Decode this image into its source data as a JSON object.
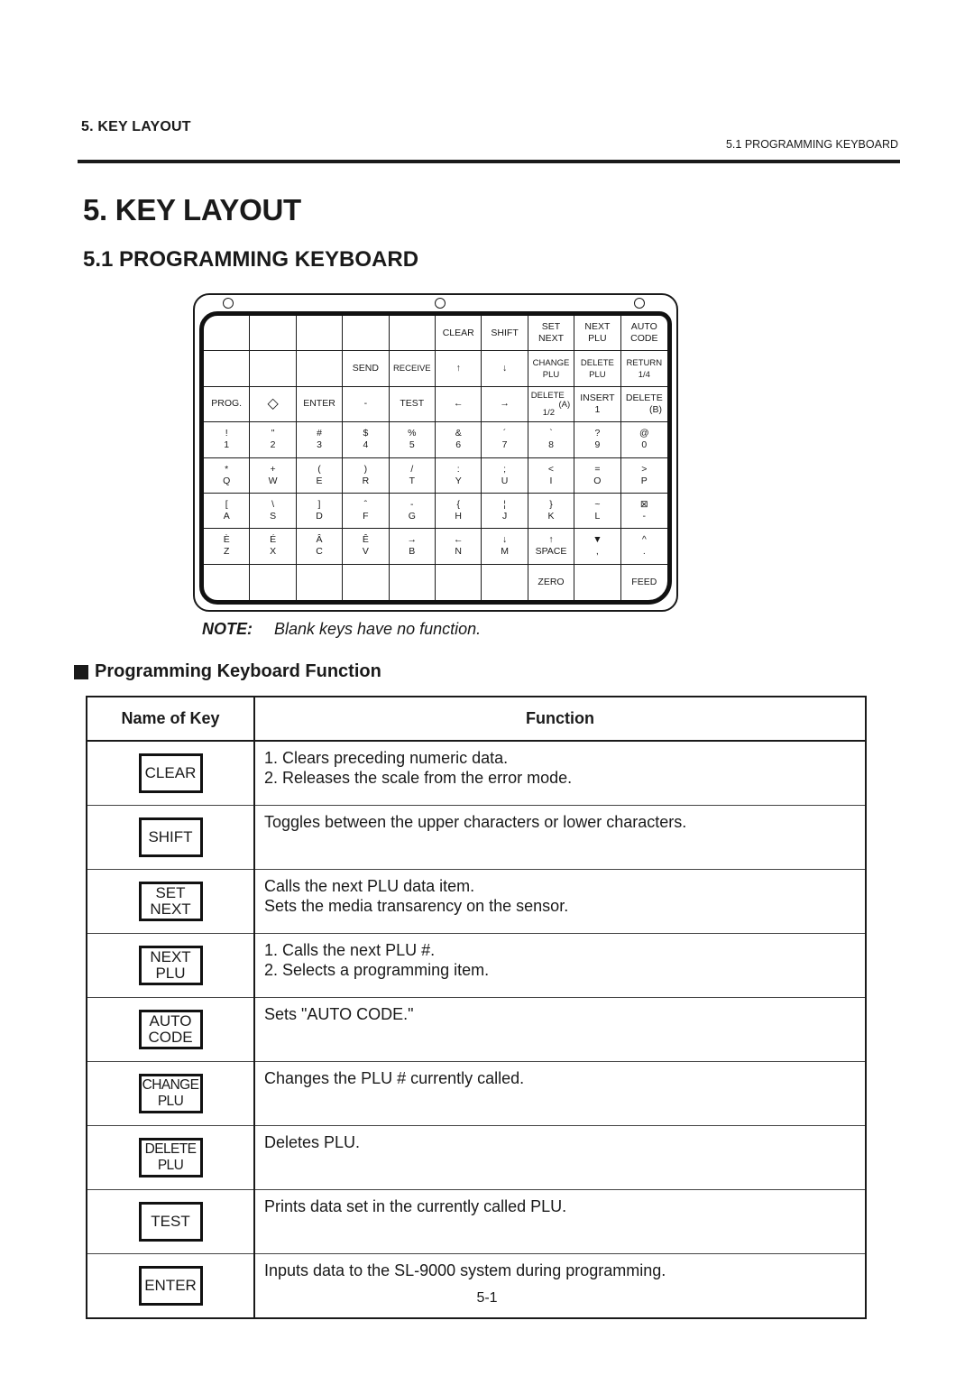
{
  "header": {
    "chapter": "5.  KEY LAYOUT",
    "section": "5.1 PROGRAMMING KEYBOARD"
  },
  "chapter_title": "5. KEY LAYOUT",
  "section_title": "5.1  PROGRAMMING KEYBOARD",
  "keyboard": {
    "rows": [
      [
        {
          "top": "",
          "bottom": ""
        },
        {
          "top": "",
          "bottom": ""
        },
        {
          "top": "",
          "bottom": ""
        },
        {
          "top": "",
          "bottom": ""
        },
        {
          "top": "",
          "bottom": ""
        },
        {
          "top": "",
          "bottom": "CLEAR"
        },
        {
          "top": "",
          "bottom": "SHIFT"
        },
        {
          "top": "SET",
          "bottom": "NEXT"
        },
        {
          "top": "NEXT",
          "bottom": "PLU"
        },
        {
          "top": "AUTO",
          "bottom": "CODE"
        }
      ],
      [
        {
          "top": "",
          "bottom": ""
        },
        {
          "top": "",
          "bottom": ""
        },
        {
          "top": "",
          "bottom": ""
        },
        {
          "top": "",
          "bottom": "SEND"
        },
        {
          "top": "",
          "bottom": "RECEIVE",
          "small": true
        },
        {
          "top": "",
          "bottom": "↑"
        },
        {
          "top": "",
          "bottom": "↓"
        },
        {
          "top": "CHANGE",
          "bottom": "PLU",
          "small": true
        },
        {
          "top": "DELETE",
          "bottom": "PLU",
          "small": true
        },
        {
          "top": "RETURN",
          "bottom": "1/4",
          "small": true
        }
      ],
      [
        {
          "top": "",
          "bottom": "PROG."
        },
        {
          "top": "",
          "bottom": "◇",
          "icon": "diamond-icon"
        },
        {
          "top": "",
          "bottom": "ENTER"
        },
        {
          "top": "",
          "bottom": "-"
        },
        {
          "top": "",
          "bottom": "TEST"
        },
        {
          "top": "",
          "bottom": "←"
        },
        {
          "top": "",
          "bottom": "→"
        },
        {
          "top": "DELETE",
          "bottom": "1/2",
          "extra": "(A)",
          "special": "delete-a"
        },
        {
          "top": "INSERT",
          "bottom": "1"
        },
        {
          "top": "DELETE",
          "bottom": "(B)",
          "special": "delete-b"
        }
      ],
      [
        {
          "top": "!",
          "bottom": "1"
        },
        {
          "top": "\"",
          "bottom": "2"
        },
        {
          "top": "#",
          "bottom": "3"
        },
        {
          "top": "$",
          "bottom": "4"
        },
        {
          "top": "%",
          "bottom": "5"
        },
        {
          "top": "&",
          "bottom": "6"
        },
        {
          "top": "´",
          "bottom": "7"
        },
        {
          "top": "`",
          "bottom": "8"
        },
        {
          "top": "?",
          "bottom": "9"
        },
        {
          "top": "@",
          "bottom": "0"
        }
      ],
      [
        {
          "top": "*",
          "bottom": "Q"
        },
        {
          "top": "+",
          "bottom": "W"
        },
        {
          "top": "(",
          "bottom": "E"
        },
        {
          "top": ")",
          "bottom": "R"
        },
        {
          "top": "/",
          "bottom": "T"
        },
        {
          "top": ":",
          "bottom": "Y"
        },
        {
          "top": ";",
          "bottom": "U"
        },
        {
          "top": "<",
          "bottom": "I"
        },
        {
          "top": "=",
          "bottom": "O"
        },
        {
          "top": ">",
          "bottom": "P"
        }
      ],
      [
        {
          "top": "[",
          "bottom": "A"
        },
        {
          "top": "\\",
          "bottom": "S"
        },
        {
          "top": "]",
          "bottom": "D"
        },
        {
          "top": "ˆ",
          "bottom": "F"
        },
        {
          "top": "-",
          "bottom": "G"
        },
        {
          "top": "{",
          "bottom": "H"
        },
        {
          "top": "¦",
          "bottom": "J"
        },
        {
          "top": "}",
          "bottom": "K"
        },
        {
          "top": "~",
          "bottom": "L"
        },
        {
          "top": "⊠",
          "bottom": "-"
        }
      ],
      [
        {
          "top": "È",
          "bottom": "Z"
        },
        {
          "top": "É",
          "bottom": "X"
        },
        {
          "top": "Â",
          "bottom": "C"
        },
        {
          "top": "Ê",
          "bottom": "V"
        },
        {
          "top": "→",
          "bottom": "B"
        },
        {
          "top": "←",
          "bottom": "N"
        },
        {
          "top": "↓",
          "bottom": "M"
        },
        {
          "top": "↑",
          "bottom": "SPACE"
        },
        {
          "top": "▼",
          "bottom": ","
        },
        {
          "top": "^",
          "bottom": "."
        }
      ],
      [
        {
          "top": "",
          "bottom": ""
        },
        {
          "top": "",
          "bottom": ""
        },
        {
          "top": "",
          "bottom": ""
        },
        {
          "top": "",
          "bottom": ""
        },
        {
          "top": "",
          "bottom": ""
        },
        {
          "top": "",
          "bottom": ""
        },
        {
          "top": "",
          "bottom": ""
        },
        {
          "top": "",
          "bottom": "ZERO"
        },
        {
          "top": "",
          "bottom": ""
        },
        {
          "top": "",
          "bottom": "FEED"
        }
      ]
    ]
  },
  "note": {
    "label": "NOTE:",
    "text": "Blank keys have no function."
  },
  "function_section": {
    "title": "Programming Keyboard Function",
    "headers": {
      "key": "Name of Key",
      "function": "Function"
    },
    "rows": [
      {
        "key": [
          "CLEAR"
        ],
        "lines": [
          "1.  Clears preceding numeric data.",
          "2.  Releases the scale from the error mode."
        ]
      },
      {
        "key": [
          "SHIFT"
        ],
        "lines": [
          "Toggles between the upper characters or lower characters."
        ]
      },
      {
        "key": [
          "SET",
          "NEXT"
        ],
        "lines": [
          "Calls the next PLU data item.",
          "Sets the media transarency on the sensor."
        ]
      },
      {
        "key": [
          "NEXT",
          "PLU"
        ],
        "lines": [
          "1.  Calls the next PLU #.",
          "2.  Selects a programming item."
        ]
      },
      {
        "key": [
          "AUTO",
          "CODE"
        ],
        "lines": [
          "Sets \"AUTO CODE.\""
        ]
      },
      {
        "key": [
          "CHANGE",
          "PLU"
        ],
        "lines": [
          "Changes the PLU # currently called."
        ]
      },
      {
        "key": [
          "DELETE",
          "PLU"
        ],
        "lines": [
          "Deletes PLU."
        ]
      },
      {
        "key": [
          "TEST"
        ],
        "lines": [
          "Prints data set in the currently called PLU."
        ]
      },
      {
        "key": [
          "ENTER"
        ],
        "lines": [
          "Inputs data to the SL-9000 system during programming."
        ]
      }
    ]
  },
  "page_number": "5-1"
}
